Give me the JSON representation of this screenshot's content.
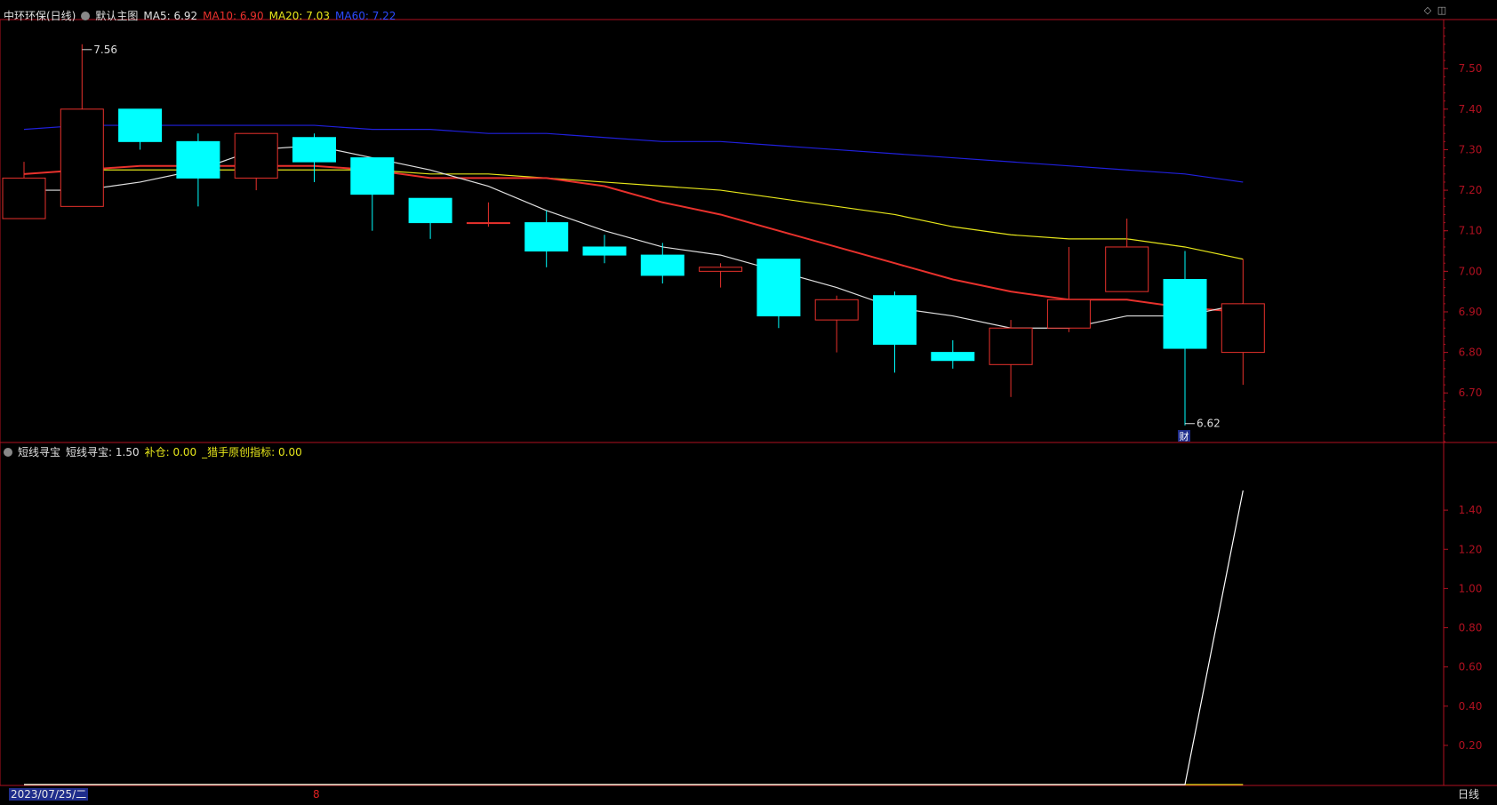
{
  "main_header": {
    "stock": "中环环保(日线)",
    "template": "默认主图",
    "ma5": "MA5: 6.92",
    "ma10": "MA10: 6.90",
    "ma20": "MA20: 7.03",
    "ma60": "MA60: 7.22"
  },
  "sub_header": {
    "indicator": "短线寻宝",
    "value1": "短线寻宝: 1.50",
    "value2": "补仓: 0.00",
    "value3": "_猎手原创指标: 0.00"
  },
  "bottom_bar": {
    "date": "2023/07/25/二",
    "x_tick": "8",
    "period": "日线"
  },
  "colors": {
    "up": "#e8312c",
    "down": "#00ffff",
    "ma5": "#e0e0e0",
    "ma10": "#e8312c",
    "ma20": "#e6e61a",
    "ma60": "#2020dd",
    "axis": "#b01020"
  },
  "chart_data": [
    {
      "type": "candlestick",
      "ylim": [
        6.58,
        7.61
      ],
      "y_ticks": [
        "7.50",
        "7.40",
        "7.30",
        "7.20",
        "7.10",
        "7.00",
        "6.90",
        "6.80",
        "6.70"
      ],
      "candles": [
        {
          "o": 7.13,
          "c": 7.23,
          "h": 7.27,
          "l": 7.13
        },
        {
          "o": 7.16,
          "c": 7.4,
          "h": 7.56,
          "l": 7.16
        },
        {
          "o": 7.4,
          "c": 7.32,
          "h": 7.4,
          "l": 7.3
        },
        {
          "o": 7.32,
          "c": 7.23,
          "h": 7.34,
          "l": 7.16
        },
        {
          "o": 7.23,
          "c": 7.34,
          "h": 7.34,
          "l": 7.2
        },
        {
          "o": 7.33,
          "c": 7.27,
          "h": 7.34,
          "l": 7.22
        },
        {
          "o": 7.28,
          "c": 7.19,
          "h": 7.28,
          "l": 7.1
        },
        {
          "o": 7.18,
          "c": 7.12,
          "h": 7.18,
          "l": 7.08
        },
        {
          "o": 7.12,
          "c": 7.12,
          "h": 7.17,
          "l": 7.11
        },
        {
          "o": 7.12,
          "c": 7.05,
          "h": 7.15,
          "l": 7.01
        },
        {
          "o": 7.06,
          "c": 7.04,
          "h": 7.09,
          "l": 7.02
        },
        {
          "o": 7.04,
          "c": 6.99,
          "h": 7.07,
          "l": 6.97
        },
        {
          "o": 7.0,
          "c": 7.01,
          "h": 7.02,
          "l": 6.96
        },
        {
          "o": 7.03,
          "c": 6.89,
          "h": 7.03,
          "l": 6.86
        },
        {
          "o": 6.88,
          "c": 6.93,
          "h": 6.94,
          "l": 6.8
        },
        {
          "o": 6.94,
          "c": 6.82,
          "h": 6.95,
          "l": 6.75
        },
        {
          "o": 6.8,
          "c": 6.78,
          "h": 6.83,
          "l": 6.76
        },
        {
          "o": 6.77,
          "c": 6.86,
          "h": 6.88,
          "l": 6.69
        },
        {
          "o": 6.86,
          "c": 6.93,
          "h": 7.06,
          "l": 6.85
        },
        {
          "o": 6.95,
          "c": 7.06,
          "h": 7.13,
          "l": 6.95
        },
        {
          "o": 6.98,
          "c": 6.81,
          "h": 7.05,
          "l": 6.62
        },
        {
          "o": 6.8,
          "c": 6.92,
          "h": 7.03,
          "l": 6.72
        }
      ],
      "ma5": [
        7.2,
        7.2,
        7.22,
        7.25,
        7.3,
        7.31,
        7.28,
        7.25,
        7.21,
        7.15,
        7.1,
        7.06,
        7.04,
        7.0,
        6.96,
        6.91,
        6.89,
        6.86,
        6.86,
        6.89,
        6.89,
        6.92
      ],
      "ma10": [
        7.24,
        7.25,
        7.26,
        7.26,
        7.26,
        7.26,
        7.25,
        7.23,
        7.23,
        7.23,
        7.21,
        7.17,
        7.14,
        7.1,
        7.06,
        7.02,
        6.98,
        6.95,
        6.93,
        6.93,
        6.91,
        6.9
      ],
      "ma20": [
        7.24,
        7.25,
        7.25,
        7.25,
        7.25,
        7.25,
        7.25,
        7.24,
        7.24,
        7.23,
        7.22,
        7.21,
        7.2,
        7.18,
        7.16,
        7.14,
        7.11,
        7.09,
        7.08,
        7.08,
        7.06,
        7.03
      ],
      "ma60": [
        7.35,
        7.36,
        7.36,
        7.36,
        7.36,
        7.36,
        7.35,
        7.35,
        7.34,
        7.34,
        7.33,
        7.32,
        7.32,
        7.31,
        7.3,
        7.29,
        7.28,
        7.27,
        7.26,
        7.25,
        7.24,
        7.22
      ],
      "annotations": [
        {
          "label": "7.56",
          "candle": 1,
          "value": 7.56
        },
        {
          "label": "6.62",
          "candle": 20,
          "value": 6.62
        }
      ],
      "marker": {
        "label": "财",
        "candle": 20
      }
    },
    {
      "type": "line",
      "ylim": [
        0,
        1.6
      ],
      "y_ticks": [
        "1.40",
        "1.20",
        "1.00",
        "0.80",
        "0.60",
        "0.40",
        "0.20"
      ],
      "series": [
        {
          "color": "#ffffff",
          "values": [
            0,
            0,
            0,
            0,
            0,
            0,
            0,
            0,
            0,
            0,
            0,
            0,
            0,
            0,
            0,
            0,
            0,
            0,
            0,
            0,
            0,
            1.5
          ]
        },
        {
          "color": "#e6e61a",
          "values": [
            0,
            0,
            0,
            0,
            0,
            0,
            0,
            0,
            0,
            0,
            0,
            0,
            0,
            0,
            0,
            0,
            0,
            0,
            0,
            0,
            0,
            0
          ]
        }
      ]
    }
  ]
}
